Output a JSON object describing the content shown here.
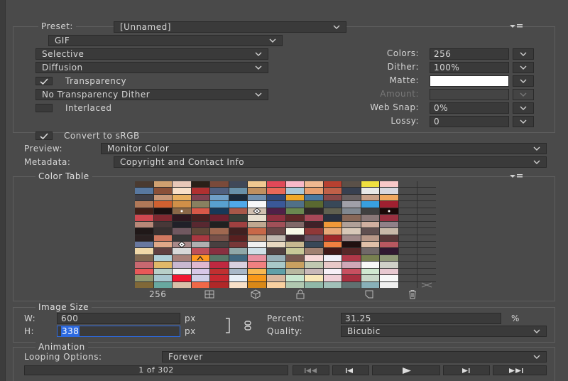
{
  "preset": {
    "label": "Preset:",
    "value": "[Unnamed]"
  },
  "format": {
    "value": "GIF"
  },
  "reduction": {
    "value": "Selective"
  },
  "dither_algorithm": {
    "value": "Diffusion"
  },
  "transparency": {
    "label": "Transparency",
    "checked": true
  },
  "transparency_dither": {
    "value": "No Transparency Dither"
  },
  "interlaced": {
    "label": "Interlaced",
    "checked": false
  },
  "colors": {
    "label": "Colors:",
    "value": "256"
  },
  "dither": {
    "label": "Dither:",
    "value": "100%"
  },
  "matte": {
    "label": "Matte:",
    "color": "#ffffff"
  },
  "amount": {
    "label": "Amount:",
    "value": ""
  },
  "web_snap": {
    "label": "Web Snap:",
    "value": "0%"
  },
  "lossy": {
    "label": "Lossy:",
    "value": "0"
  },
  "convert_srgb": {
    "label": "Convert to sRGB",
    "checked": true
  },
  "preview": {
    "label": "Preview:",
    "value": "Monitor Color"
  },
  "metadata": {
    "label": "Metadata:",
    "value": "Copyright and Contact Info"
  },
  "color_table": {
    "title": "Color Table",
    "count": "256",
    "colors": [
      "#4a3a30",
      "#cfa070",
      "#e8c8b8",
      "#2a2018",
      "#7a4a3a",
      "#404858",
      "#f0c890",
      "#e04858",
      "#f8b8c8",
      "#f0b890",
      "#b84030",
      "#5a5048",
      "#f0e040",
      "#f8c8c8",
      "#4a4a4a",
      "#4a4a4a",
      "#5878a0",
      "#8a5038",
      "#f8e0c8",
      "#b03030",
      "#506080",
      "#6890a8",
      "#c09060",
      "#e86858",
      "#a8c8d8",
      "#e8a070",
      "#c06048",
      "#384050",
      "#e8e8e8",
      "#d8d8e0",
      "#4a4a4a",
      "#4a4a4a",
      "#404048",
      "#c89878",
      "#e8b060",
      "#804050",
      "#70a0c8",
      "#1a2838",
      "#7090b0",
      "#304878",
      "#f0a828",
      "#4878a0",
      "#8a4848",
      "#686060",
      "#c8a088",
      "#f0a860",
      "#4a4a4a",
      "#4a4a4a",
      "#b07858",
      "#d06030",
      "#d09048",
      "#888060",
      "#58a0d0",
      "#50a8e8",
      "#f8f8f8",
      "#3a5898",
      "#507088",
      "#5a6830",
      "#384858",
      "#a0a0a8",
      "#38a0e0",
      "#a02030",
      "#4a4a4a",
      "#4a4a4a",
      "#402018",
      "#1a1010",
      "#8a6848",
      "#d85848",
      "#183858",
      "#a85848",
      "#d0c0b0",
      "#502048",
      "#6a8850",
      "#302828",
      "#606050",
      "#808890",
      "#404040",
      "#1a0808",
      "#4a4a4a",
      "#4a4a4a",
      "#d04850",
      "#802830",
      "#301820",
      "#482020",
      "#702030",
      "#384038",
      "#e8e0d0",
      "#903040",
      "#602828",
      "#a84858",
      "#283040",
      "#886858",
      "#8a7878",
      "#9a3040",
      "#4a4a4a",
      "#4a4a4a",
      "#b88878",
      "#483838",
      "#202028",
      "#582830",
      "#202020",
      "#a04040",
      "#c0a890",
      "#a05058",
      "#806868",
      "#402028",
      "#f09838",
      "#b0a098",
      "#d0b0a0",
      "#908088",
      "#4a4a4a",
      "#4a4a4a",
      "#201818",
      "#383030",
      "#705860",
      "#604838",
      "#a06850",
      "#402020",
      "#c86848",
      "#684848",
      "#f8f8e8",
      "#903838",
      "#e8a878",
      "#d8c8b8",
      "#605050",
      "#c8b8a8",
      "#4a4a4a",
      "#4a4a4a",
      "#2a2020",
      "#d07860",
      "#383838",
      "#a83840",
      "#785048",
      "#582020",
      "#c09878",
      "#c0b8b0",
      "#402830",
      "#685060",
      "#a02828",
      "#a08888",
      "#b89888",
      "#583838",
      "#4a4a4a",
      "#4a4a4a",
      "#6878a0",
      "#e0a888",
      "#a88888",
      "#b0b0b0",
      "#484040",
      "#783838",
      "#f0f0f0",
      "#e8d8c0",
      "#c8b890",
      "#384858",
      "#f08040",
      "#201010",
      "#e0c0a8",
      "#b85860",
      "#4a4a4a",
      "#4a4a4a",
      "#f0d8a8",
      "#604040",
      "#d8d8d8",
      "#c05058",
      "#883040",
      "#90a8a8",
      "#d0e0e8",
      "#504040",
      "#c8c898",
      "#a08070",
      "#401818",
      "#582828",
      "#706868",
      "#301830",
      "#4a4a4a",
      "#4a4a4a",
      "#806850",
      "#b0d0d8",
      "#a88078",
      "#ff9820",
      "#587868",
      "#406880",
      "#e890a0",
      "#98b0b8",
      "#785850",
      "#f8d8d8",
      "#f0f0f8",
      "#b03848",
      "#788050",
      "#909878",
      "#4a4a4a",
      "#4a4a4a",
      "#c86870",
      "#e0b868",
      "#c8b8d0",
      "#e0b8d0",
      "#c02840",
      "#d8d0e0",
      "#f08080",
      "#a8c8c8",
      "#c8a060",
      "#c0c8b0",
      "#e8c8c8",
      "#d0a8b8",
      "#f8f8f8",
      "#d0d0c8",
      "#4a4a4a",
      "#4a4a4a",
      "#e85858",
      "#b8d0c8",
      "#f0f0f0",
      "#d8c8e8",
      "#c03030",
      "#a8b8c8",
      "#f8b850",
      "#60a0a8",
      "#b8b8a0",
      "#c8b8b8",
      "#f8f0f8",
      "#c85060",
      "#d0e8d0",
      "#e8c8d0",
      "#4a4a4a",
      "#4a4a4a",
      "#909870",
      "#a8c8d0",
      "#f01830",
      "#d0d0e8",
      "#c82830",
      "#e8f0f8",
      "#f89818",
      "#d8b8a0",
      "#c8e8d0",
      "#f8e8b8",
      "#f0d0d8",
      "#a83040",
      "#c8d8c8",
      "#f8f8f8",
      "#4a4a4a",
      "#4a4a4a",
      "#806838",
      "#68a8a0",
      "#d8c0a8",
      "#f06848",
      "#b02828",
      "#f8e0c8",
      "#d88818",
      "#f8d0a0",
      "#b0c8b0",
      "#90b8a8",
      "#a0c0b8",
      "#607070",
      "#88b0b8",
      "#f0f0f0",
      "#4a4a4a",
      "#4a4a4a"
    ],
    "marks": {
      "66": "dot",
      "70": "diamond",
      "77": "dot",
      "146": "diamond",
      "179": "caret",
      "255": "x"
    }
  },
  "image_size": {
    "title": "Image Size",
    "w_label": "W:",
    "w_value": "600",
    "w_unit": "px",
    "h_label": "H:",
    "h_value": "338",
    "h_unit": "px",
    "percent_label": "Percent:",
    "percent_value": "31.25",
    "percent_unit": "%",
    "quality_label": "Quality:",
    "quality_value": "Bicubic"
  },
  "animation": {
    "title": "Animation",
    "looping_label": "Looping Options:",
    "looping_value": "Forever",
    "frame_counter": "1 of 302"
  },
  "colors_theme": {
    "panel": "#4a4a4a",
    "field": "#3a3a3a",
    "text": "#d4d4d4",
    "selection": "#2d6ae0"
  }
}
